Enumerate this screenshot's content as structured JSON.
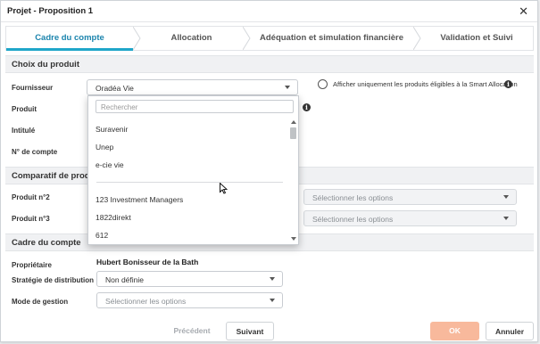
{
  "window": {
    "title": "Projet - Proposition 1"
  },
  "steps": [
    {
      "label": "Cadre du compte",
      "active": true
    },
    {
      "label": "Allocation",
      "active": false
    },
    {
      "label": "Adéquation et simulation financière",
      "active": false
    },
    {
      "label": "Validation et Suivi",
      "active": false
    }
  ],
  "choix": {
    "heading": "Choix du produit",
    "fournisseur_label": "Fournisseur",
    "fournisseur_value": "Oradéa Vie",
    "produit_label": "Produit",
    "intitule_label": "Intitulé",
    "ncompte_label": "N° de compte",
    "smart_label": "Afficher uniquement les produits éligibles à la Smart Allocation"
  },
  "dropdown": {
    "search_placeholder": "Rechercher",
    "items": [
      "Suravenir",
      "Unep",
      "e-cie vie",
      "123 Investment Managers",
      "1822direkt",
      "612"
    ]
  },
  "comparatif": {
    "heading": "Comparatif de prod",
    "produit2_label": "Produit n°2",
    "produit3_label": "Produit n°3",
    "select_placeholder": "Sélectionner les options"
  },
  "cadre": {
    "heading": "Cadre du compte",
    "proprietaire_label": "Propriétaire",
    "proprietaire_value": "Hubert Bonisseur de la Bath",
    "strategie_label": "Stratégie de distribution",
    "strategie_value": "Non définie",
    "mode_label": "Mode de gestion",
    "mode_placeholder": "Sélectionner les options"
  },
  "footer": {
    "precedent": "Précédent",
    "suivant": "Suivant",
    "ok": "OK",
    "annuler": "Annuler"
  },
  "colors": {
    "accent": "#1fa6c9",
    "ok_button": "#f8b99c"
  },
  "icons": {
    "close": "close-icon",
    "info": "info-icon",
    "smart": "smart-allocation-icon",
    "caret": "chevron-down-icon"
  }
}
